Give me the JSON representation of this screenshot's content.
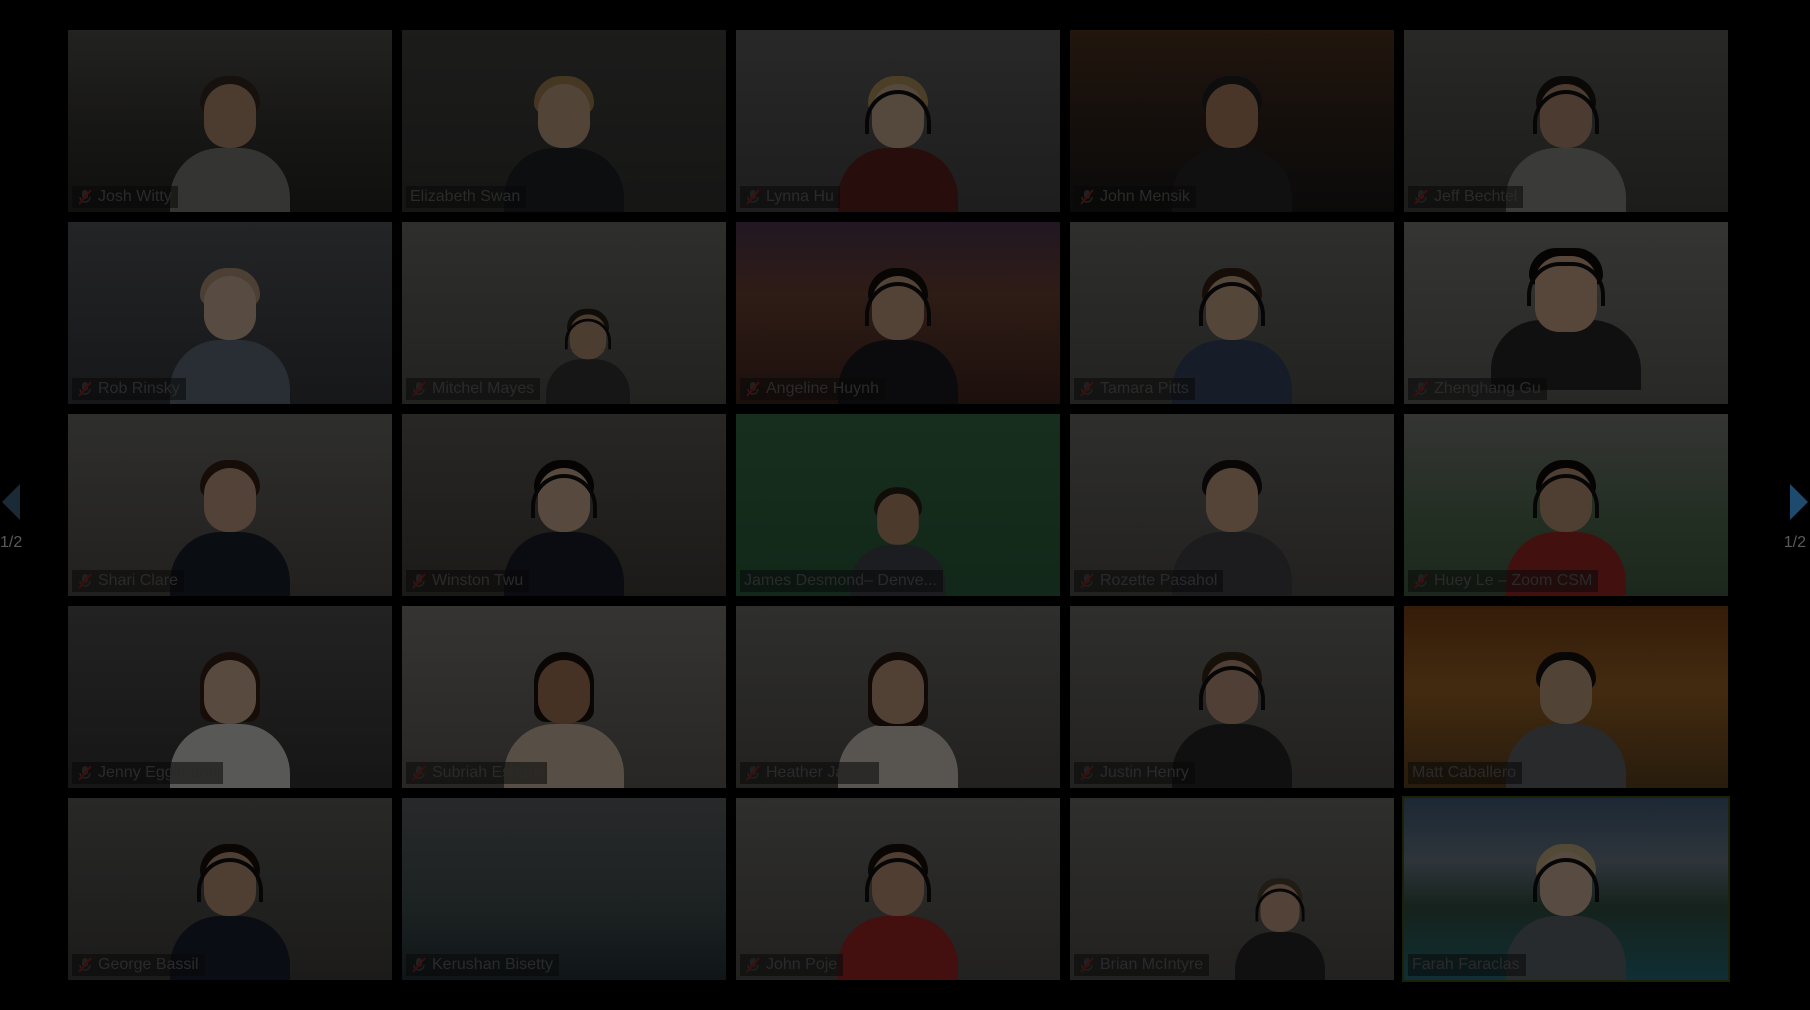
{
  "meeting": {
    "participants": [
      {
        "name": "Josh Witty",
        "muted": true
      },
      {
        "name": "Elizabeth Swan",
        "muted": false
      },
      {
        "name": "Lynna Hu",
        "muted": true
      },
      {
        "name": "John Mensik",
        "muted": true
      },
      {
        "name": "Jeff Bechtel",
        "muted": true
      },
      {
        "name": "Rob Rinsky",
        "muted": true
      },
      {
        "name": "Mitchel Mayes",
        "muted": true
      },
      {
        "name": "Angeline Huynh",
        "muted": true
      },
      {
        "name": "Tamara Pitts",
        "muted": true
      },
      {
        "name": "Zhenghang Gu",
        "muted": true
      },
      {
        "name": "Shari Clare",
        "muted": true
      },
      {
        "name": "Winston Twu",
        "muted": true
      },
      {
        "name": "James Desmond– Denve...",
        "muted": false
      },
      {
        "name": "Rozette Pasahol",
        "muted": true
      },
      {
        "name": "Huey Le – Zoom CSM",
        "muted": true
      },
      {
        "name": "Jenny Eggimann",
        "muted": true
      },
      {
        "name": "Subriah Esharc",
        "muted": true
      },
      {
        "name": "Heather Jarrett",
        "muted": true
      },
      {
        "name": "Justin Henry",
        "muted": true
      },
      {
        "name": "Matt Caballero",
        "muted": false
      },
      {
        "name": "George Bassil",
        "muted": true
      },
      {
        "name": "Kerushan Bisetty",
        "muted": true
      },
      {
        "name": "John Poje",
        "muted": true
      },
      {
        "name": "Brian McIntyre",
        "muted": true
      },
      {
        "name": "Farah Faraclas",
        "muted": false,
        "active_speaker": true
      }
    ]
  },
  "pager": {
    "left_label": "1/2",
    "right_label": "1/2"
  },
  "icons": {
    "muted_mic": "muted-mic-icon",
    "prev_page": "arrow-left-icon",
    "next_page": "arrow-right-icon"
  },
  "colors": {
    "background": "#000000",
    "active_speaker_border": "#4a5a10",
    "pager_arrow": "#1e4a6e",
    "mute_icon": "#b02020"
  }
}
